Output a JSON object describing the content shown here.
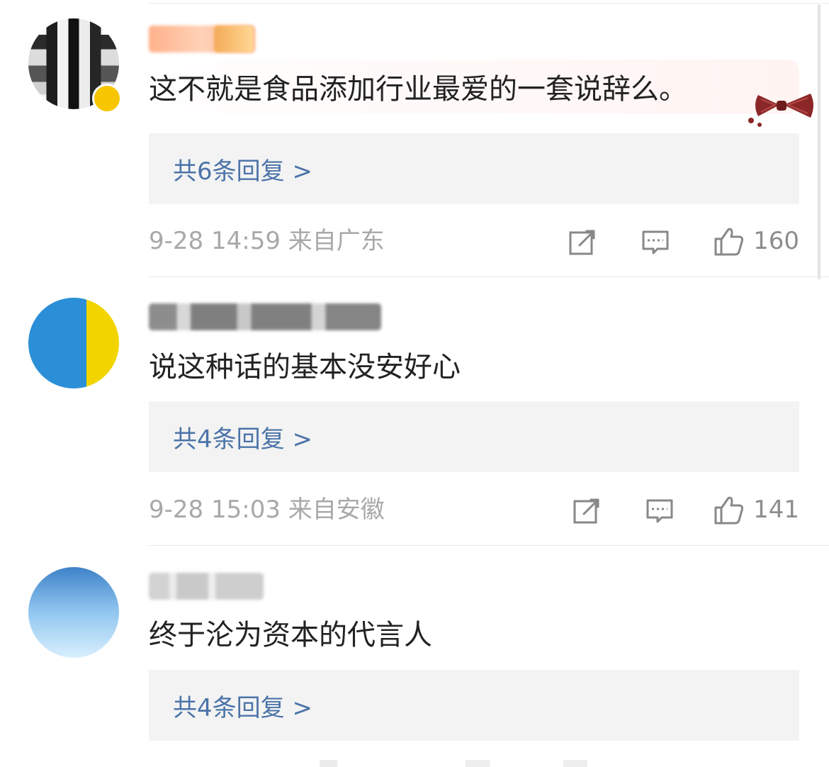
{
  "comments": [
    {
      "text": "这不就是食品添加行业最爱的一套说辞么。",
      "replies": "共6条回复 >",
      "meta": "9-28 14:59  来自广东",
      "likes": "160"
    },
    {
      "text": "说这种话的基本没安好心",
      "replies": "共4条回复 >",
      "meta": "9-28 15:03  来自安徽",
      "likes": "141"
    },
    {
      "text": "终于沦为资本的代言人",
      "replies": "共4条回复 >"
    }
  ],
  "icons": {
    "share": "share-icon",
    "comment": "comment-icon",
    "like": "thumbs-up-icon"
  },
  "colors": {
    "link": "#4b74a8",
    "meta": "#a8a8a8",
    "text": "#222222",
    "reply_bg": "#f3f3f3",
    "bow": "#8c2727"
  }
}
